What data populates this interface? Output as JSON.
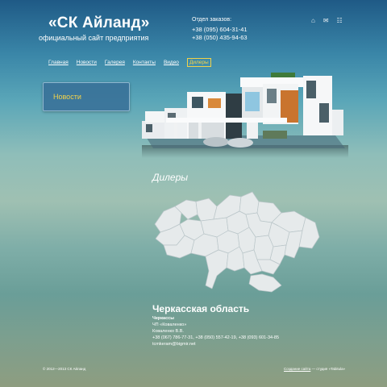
{
  "header": {
    "title": "«СК Айланд»",
    "subtitle": "официальный сайт предприятия",
    "orders_label": "Отдел заказов:",
    "phone1": "+38 (095) 604-31-41",
    "phone2": "+38 (050) 435-94-63",
    "icons": [
      "home-icon",
      "mail-icon",
      "sitemap-icon"
    ]
  },
  "nav": {
    "items": [
      "Главная",
      "Новости",
      "Галерея",
      "Контакты",
      "Видео",
      "Дилеры"
    ],
    "active": "Дилеры"
  },
  "sidebar": {
    "news_label": "Новости"
  },
  "main": {
    "heading": "Дилеры",
    "region": "Черкасская область",
    "city": "Черкассы",
    "company": "ЧП «Коваленко»",
    "person": "Коваленко В.В.",
    "phones": "+38 (067) 786-77-31, +38 (050) 557-42-19, +38 (093) 601-34-85",
    "email": "tcmkeram@bigmir.net"
  },
  "footer": {
    "copyright": "© 2012—2013 СК Айланд",
    "dev_link": "Создание сайта",
    "dev_studio": " — студия «Tabitula»"
  }
}
